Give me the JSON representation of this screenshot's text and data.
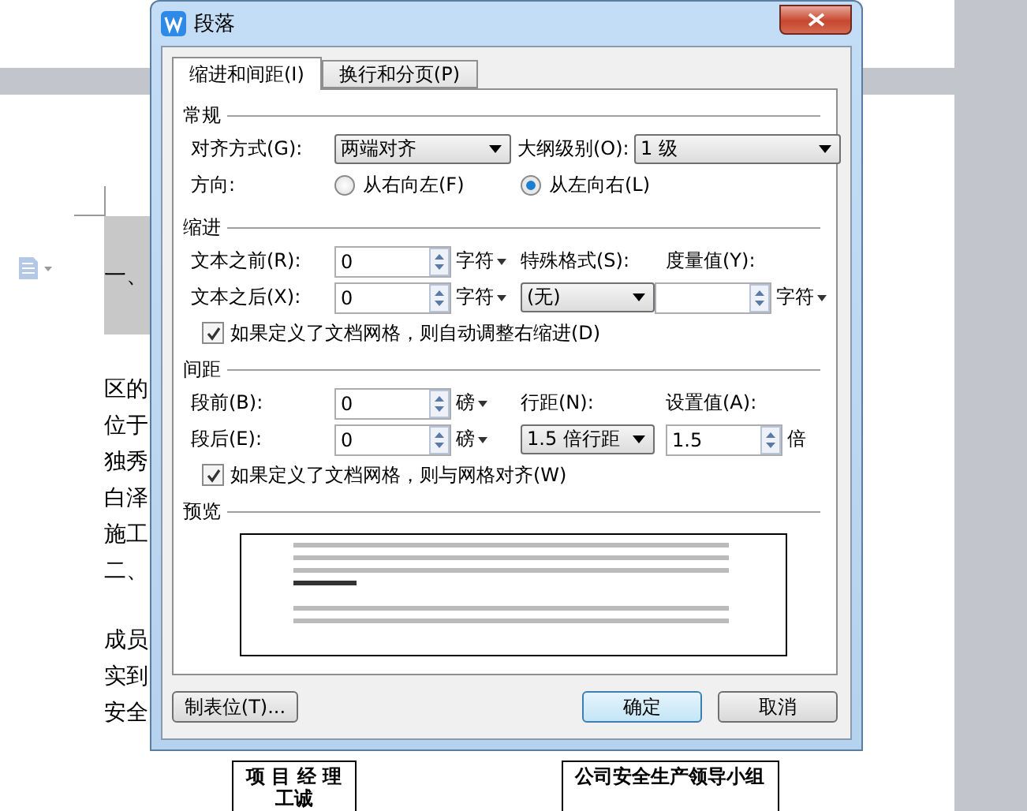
{
  "document": {
    "heading": "一、",
    "paragraphs": [
      [
        "区的",
        "位于",
        "独秀",
        "白泽",
        "施工",
        "二、"
      ],
      [
        "成员",
        "实到",
        "安全"
      ]
    ],
    "boxes": [
      {
        "lines": [
          "项 目 经 理",
          "工诚"
        ]
      },
      {
        "lines": [
          "公司安全生产领导小组"
        ]
      }
    ]
  },
  "window": {
    "title": "段落"
  },
  "tabs": [
    {
      "label": "缩进和间距(I)",
      "selected": true
    },
    {
      "label": "换行和分页(P)",
      "selected": false
    }
  ],
  "general": {
    "title": "常规",
    "alignment_label": "对齐方式(G):",
    "alignment": "两端对齐",
    "outline_label": "大纲级别(O):",
    "outline": "1 级",
    "direction_label": "方向:",
    "directions": [
      {
        "label": "从右向左(F)",
        "selected": false
      },
      {
        "label": "从左向右(L)",
        "selected": true
      }
    ]
  },
  "indent": {
    "title": "缩进",
    "before_label": "文本之前(R):",
    "before": "0",
    "before_unit": "字符",
    "special_label": "特殊格式(S):",
    "measure_label": "度量值(Y):",
    "after_label": "文本之后(X):",
    "after": "0",
    "after_unit": "字符",
    "special": "(无)",
    "measure_unit": "字符",
    "grid_option": {
      "label": "如果定义了文档网格，则自动调整右缩进(D)",
      "checked": true
    }
  },
  "spacing": {
    "title": "间距",
    "before_label": "段前(B):",
    "before": "0",
    "before_unit": "磅",
    "line_label": "行距(N):",
    "value_label": "设置值(A):",
    "after_label": "段后(E):",
    "after": "0",
    "after_unit": "磅",
    "line": "1.5 倍行距",
    "value": "1.5",
    "value_unit": "倍",
    "grid_option": {
      "label": "如果定义了文档网格，则与网格对齐(W)",
      "checked": true
    }
  },
  "preview": {
    "title": "预览"
  },
  "buttons": [
    {
      "label": "制表位(T)...",
      "kind": "secondary"
    },
    {
      "label": "确定",
      "kind": "default"
    },
    {
      "label": "取消",
      "kind": "cancel"
    }
  ]
}
